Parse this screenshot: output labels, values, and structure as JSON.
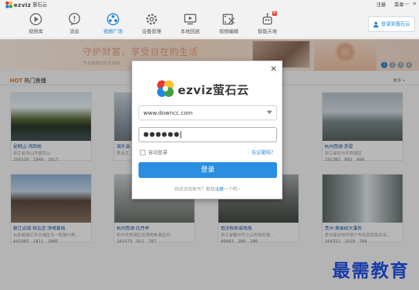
{
  "app": {
    "logo_text": "ezviz",
    "logo_cn": "萤石云",
    "menu": [
      "注册",
      "菜单"
    ],
    "controls": {
      "minimize": "—",
      "close": "✕"
    }
  },
  "toolbar": {
    "items": [
      {
        "label": "视频库",
        "icon": "play-circle-icon",
        "active": false
      },
      {
        "label": "消息",
        "icon": "message-icon",
        "active": false
      },
      {
        "label": "视频广场",
        "icon": "video-square-icon",
        "active": true
      },
      {
        "label": "设备管理",
        "icon": "gear-icon",
        "active": false
      },
      {
        "label": "本地回放",
        "icon": "monitor-play-icon",
        "active": false
      },
      {
        "label": "视频编辑",
        "icon": "film-edit-icon",
        "active": false
      },
      {
        "label": "智能天地",
        "icon": "robot-icon",
        "active": false,
        "badge": "新"
      }
    ],
    "login_label": "登录到萤石云"
  },
  "banner": {
    "headline": "守护财富，享受自在的生活",
    "sub": "专业级移动安全系统",
    "pages": [
      "1",
      "2",
      "3",
      "4"
    ],
    "active_page": "1"
  },
  "section": {
    "hot_label": "HOT",
    "title": "热门直播",
    "more": "更多 »"
  },
  "cards": [
    {
      "title": "昆明山·湾四地",
      "sub": "浙江省舟山市普陀山",
      "views": "350109",
      "likes": "1946",
      "comments": "1917"
    },
    {
      "title": "海外演...",
      "sub": "黑龙江...",
      "views": "",
      "likes": "",
      "comments": ""
    },
    {
      "title": "",
      "sub": "",
      "views": "",
      "likes": "",
      "comments": ""
    },
    {
      "title": "杭州西湖·苏堤",
      "sub": "浙江省杭州市西湖区",
      "views": "191383",
      "likes": "892",
      "comments": "666"
    },
    {
      "title": "丽江古城·祥云庄·净地客栈",
      "sub": "云南省丽江市古城区五一街振兴巷...",
      "views": "442085",
      "likes": "1811",
      "comments": "1885"
    },
    {
      "title": "杭州西湖·灶丹亭",
      "sub": "杭州市西湖区花港观鱼景区内",
      "views": "181079",
      "likes": "921",
      "comments": "787"
    },
    {
      "title": "恒沃牧养高地场",
      "sub": "浙江省衢州市江山市保安镇...",
      "views": "49483",
      "likes": "280",
      "comments": "186"
    },
    {
      "title": "贵州·黄果树大瀑布",
      "sub": "贵州省安顺市镇宁布依族苗族自治...",
      "views": "164351",
      "likes": "1018",
      "comments": "769"
    }
  ],
  "login": {
    "logo_text": "ezviz萤石云",
    "account_value": "www.downcc.com",
    "password_masked": "●●●●●●",
    "auto_login_label": "自动登录",
    "forgot_label": "忘记密码？",
    "submit_label": "登录",
    "register_prefix": "你还没有账号？那就",
    "register_link": "注册",
    "register_suffix": "一个吧~"
  },
  "watermark": "最需教育"
}
